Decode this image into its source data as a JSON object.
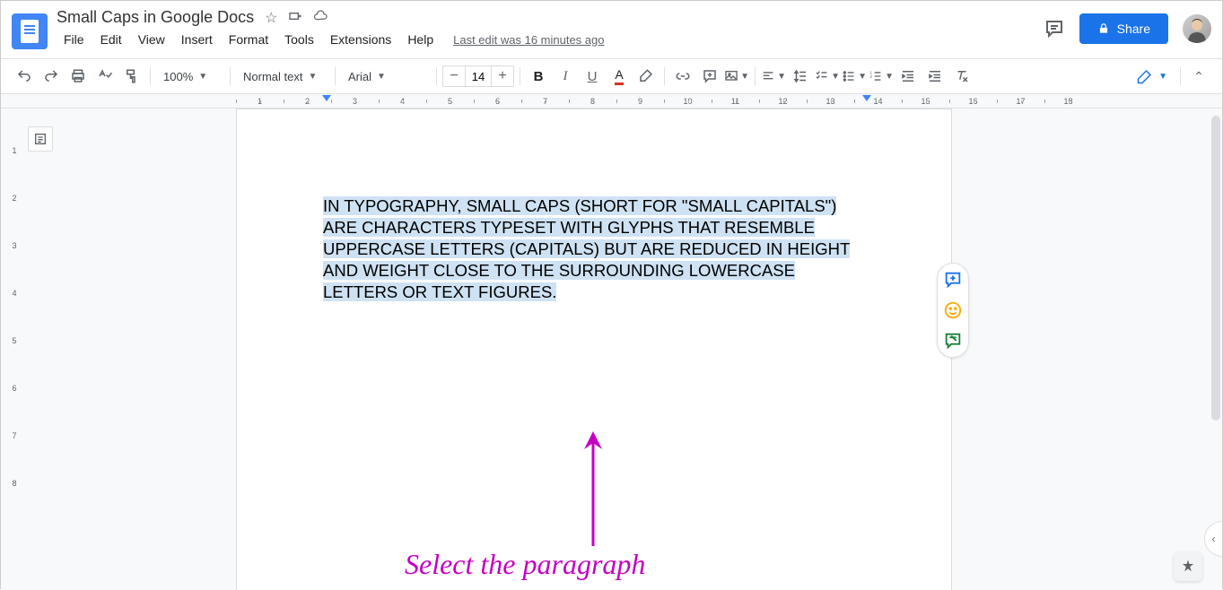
{
  "document": {
    "title": "Small Caps in Google Docs",
    "last_edit": "Last edit was 16 minutes ago"
  },
  "menubar": [
    "File",
    "Edit",
    "View",
    "Insert",
    "Format",
    "Tools",
    "Extensions",
    "Help"
  ],
  "toolbar": {
    "zoom": "100%",
    "styles": "Normal text",
    "font": "Arial",
    "font_size": "14"
  },
  "share": {
    "label": "Share"
  },
  "ruler": {
    "h_max": 18,
    "v_max": 8
  },
  "body_text": "IN TYPOGRAPHY, SMALL CAPS (SHORT FOR \"SMALL CAPITALS\") ARE CHARACTERS TYPESET WITH GLYPHS THAT RESEMBLE UPPERCASE LETTERS (CAPITALS) BUT ARE REDUCED IN HEIGHT AND WEIGHT CLOSE TO THE SURROUNDING LOWERCASE LETTERS OR TEXT FIGURES.",
  "annotation": "Select the paragraph"
}
